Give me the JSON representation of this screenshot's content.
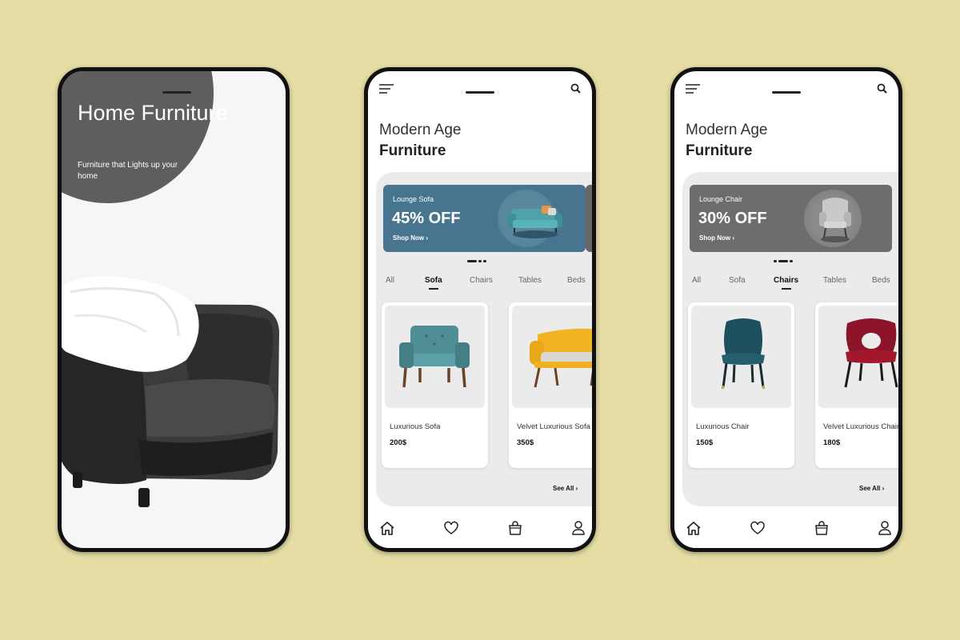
{
  "colors": {
    "background": "#e5dda4",
    "circle": "#5e5f5d",
    "sofa_banner": "#47758f",
    "chair_banner": "#6d6d6d"
  },
  "splash": {
    "title": "Home Furniture",
    "subtitle": "Furniture that Lights up your home"
  },
  "screens": [
    {
      "heading1": "Modern Age",
      "heading2": "Furniture",
      "banner": {
        "label": "Lounge Sofa",
        "offer": "45% OFF",
        "cta": "Shop Now ›"
      },
      "categories": [
        "All",
        "Sofa",
        "Chairs",
        "Tables",
        "Beds"
      ],
      "active_category": "Sofa",
      "products": [
        {
          "name": "Luxurious Sofa",
          "price": "200$"
        },
        {
          "name": "Velvet Luxurious Sofa",
          "price": "350$"
        }
      ],
      "see_all": "See All ›"
    },
    {
      "heading1": "Modern Age",
      "heading2": "Furniture",
      "banner": {
        "label": "Lounge Chair",
        "offer": "30% OFF",
        "cta": "Shop Now ›"
      },
      "categories": [
        "All",
        "Sofa",
        "Chairs",
        "Tables",
        "Beds"
      ],
      "active_category": "Chairs",
      "products": [
        {
          "name": "Luxurious Chair",
          "price": "150$"
        },
        {
          "name": "Velvet Luxurious Chair",
          "price": "180$"
        }
      ],
      "see_all": "See All ›"
    }
  ],
  "nav_icons": [
    "home-icon",
    "heart-icon",
    "bag-icon",
    "user-icon"
  ]
}
